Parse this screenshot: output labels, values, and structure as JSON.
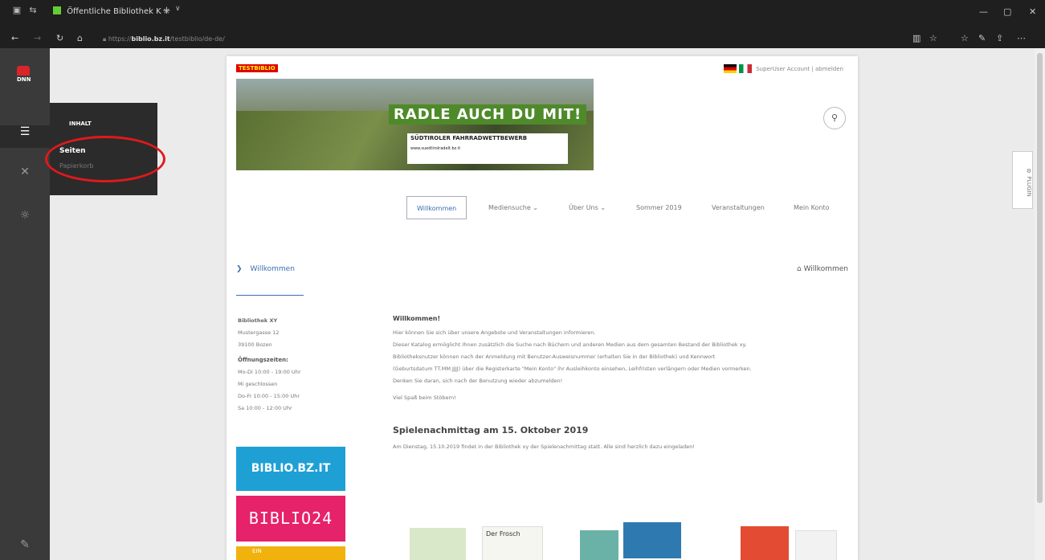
{
  "browser": {
    "tab_title": "Öffentliche Bibliothek K",
    "tab_close": "×",
    "new_tab": "+",
    "tab_menu": "∨",
    "address_prefix": "https://",
    "address_domain": "biblio.bz.it",
    "address_path": "/testbiblio/de-de/",
    "back": "←",
    "forward": "→",
    "refresh": "↻",
    "home": "⌂",
    "min": "—",
    "max": "▢",
    "close": "✕"
  },
  "dnn": {
    "logo_text": "DNN",
    "flyout": {
      "header": "INHALT",
      "item_pages": "Seiten",
      "item_recycle": "Papierkorb"
    }
  },
  "site": {
    "brand": "TESTBIBLIO",
    "account": "SuperUser Account",
    "separator": "|",
    "logout": "abmelden",
    "banner_headline": "RADLE AUCH DU MIT!",
    "banner_sub": "SÜDTIROLER FAHRRADWETTBEWERB",
    "banner_url": "www.suedtirolradelt.bz.it",
    "menu": [
      "Willkommen",
      "Mediensuche ⌄",
      "Über Uns ⌄",
      "Sommer 2019",
      "Veranstaltungen",
      "Mein Konto"
    ],
    "breadcrumb": "Willkommen",
    "breadcrumb_right": "Willkommen",
    "library": {
      "name": "Bibliothek XY",
      "street": "Mustergasse 12",
      "city": "39100 Bozen",
      "hours_title": "Öffnungszeiten:",
      "hours": [
        "Mo-Di  10:00 - 19:00 Uhr",
        "Mi       geschlossen",
        "Do-Fr  10:00 - 15:00 Uhr",
        "Sa       10:00 - 12:00 Uhr"
      ]
    },
    "logo_biblio": "BIBLIO.BZ.IT",
    "logo_biblio24": "BIBLIO24",
    "logo_third": "EIN",
    "welcome_title": "Willkommen!",
    "welcome_lines": [
      "Hier können Sie sich über unsere Angebote und Veranstaltungen informieren.",
      "Dieser Katalog ermöglicht Ihnen zusätzlich die Suche nach Büchern und anderen Medien aus dem gesamten Bestand der Bibliothek xy.",
      "Bibliotheksnutzer können nach der Anmeldung mit Benutzer-Ausweisnummer (erhalten Sie in der Bibliothek) und Kennwort",
      "(Geburtsdatum TT.MM.JJJJ) über die Registerkarte \"Mein Konto\" ihr Ausleihkonto einsehen, Leihfristen verlängern oder Medien vormerken.",
      "Denken Sie daran, sich nach der Benutzung wieder abzumelden!"
    ],
    "welcome_end": "Viel Spaß beim Stöbern!",
    "event_title": "Spielenachmittag am 15. Oktober 2019",
    "event_text": "Am Dienstag, 15.10.2019 findet in der Bibliothek xy der Spielenachmittag statt. Alle sind herzlich dazu eingeladen!",
    "book_title": "Der Frosch",
    "plugin_label": "PLUGIN"
  }
}
